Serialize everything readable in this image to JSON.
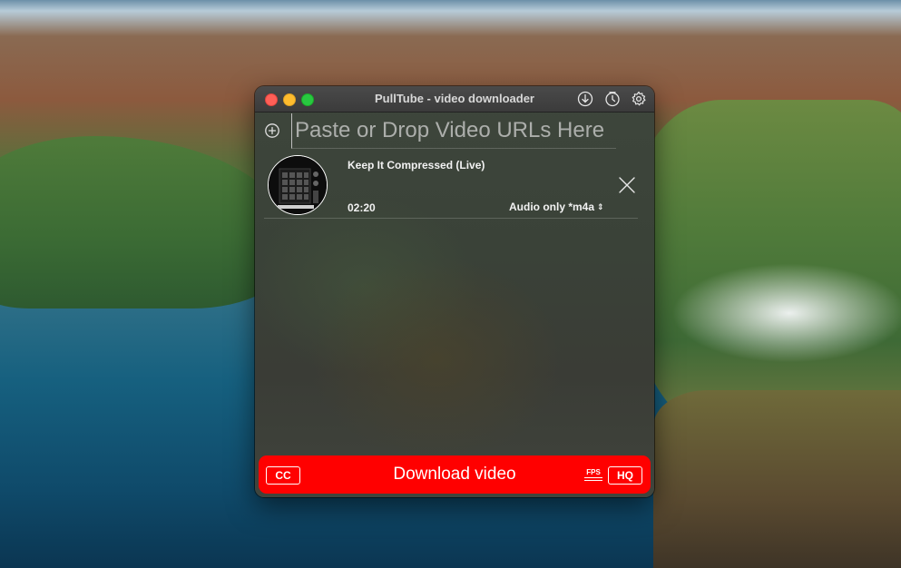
{
  "window": {
    "title": "PullTube - video downloader"
  },
  "toolbar": {
    "icons": [
      "download-icon",
      "history-icon",
      "settings-icon"
    ]
  },
  "url_input": {
    "placeholder": "Paste or Drop Video URLs Here",
    "value": ""
  },
  "video_item": {
    "title": "Keep It Compressed (Live)",
    "duration": "02:20",
    "format": "Audio only *m4a",
    "thumbnail_icon": "album-art"
  },
  "download_bar": {
    "label": "Download video",
    "cc_label": "CC",
    "fps_label": "FPS",
    "hq_label": "HQ",
    "color": "#ff0000"
  }
}
